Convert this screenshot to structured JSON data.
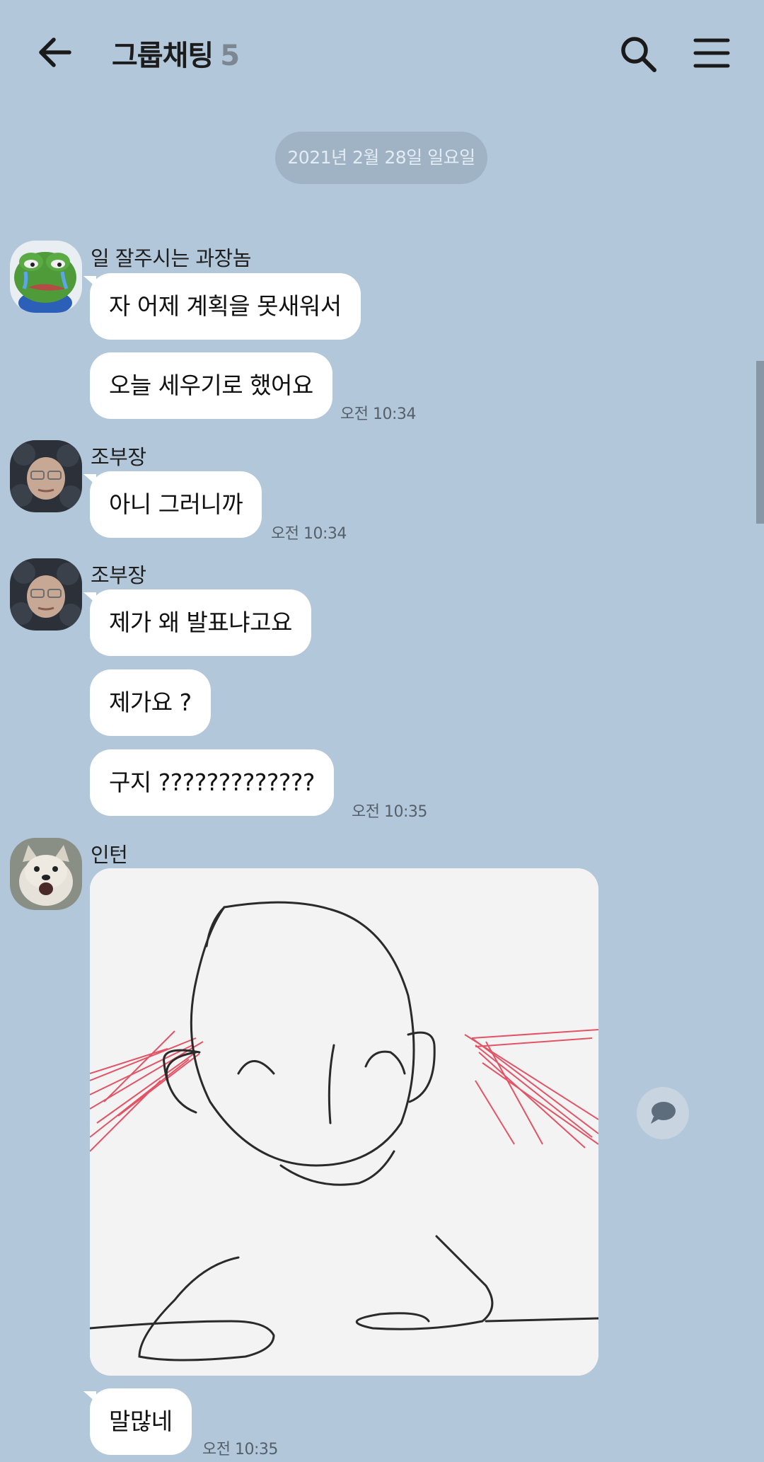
{
  "header": {
    "back_icon": "back-arrow-icon",
    "title": "그룹채팅",
    "member_count": "5",
    "search_icon": "search-icon",
    "menu_icon": "menu-icon"
  },
  "date_divider": "2021년 2월 28일 일요일",
  "messages": [
    {
      "sender": "일 잘주시는 과장놈",
      "avatar": "frog-avatar",
      "bubbles": [
        "자 어제 계획을 못새워서",
        "오늘 세우기로 했어요"
      ],
      "time": "오전 10:34"
    },
    {
      "sender": "조부장",
      "avatar": "person-avatar",
      "bubbles": [
        "아니 그러니까"
      ],
      "time": "오전 10:34"
    },
    {
      "sender": "조부장",
      "avatar": "person-avatar",
      "bubbles": [
        "제가 왜 발표냐고요",
        "제가요 ?",
        "구지 ?????????????"
      ],
      "time": "오전 10:35"
    },
    {
      "sender": "인턴",
      "avatar": "dog-avatar",
      "image": "face-drawing-image",
      "bubbles": [
        "말많네"
      ],
      "time": "오전 10:35"
    }
  ],
  "share_icon": "speech-bubble-icon",
  "colors": {
    "background": "#b2c7da",
    "bubble": "#ffffff",
    "date_pill": "#9fb3c5",
    "time_text": "#55606b"
  }
}
